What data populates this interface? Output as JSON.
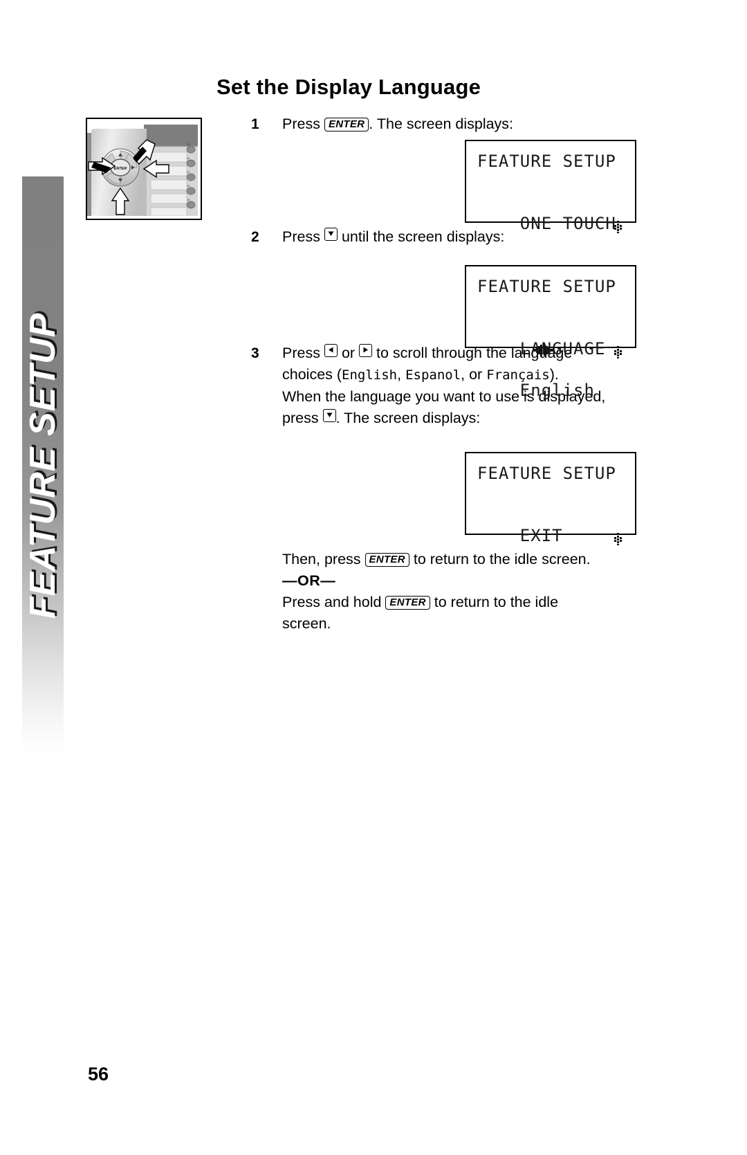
{
  "side_tab": {
    "label": "FEATURE SETUP"
  },
  "page": {
    "title": "Set the Display Language",
    "number": "56"
  },
  "figure": {
    "name": "phone-navigation-keypad-illustration",
    "enter_key_label": "ENTER",
    "speed_dial_labels": [
      "10",
      "11",
      "12",
      "13",
      "14"
    ]
  },
  "steps": [
    {
      "num": "1",
      "text_before": "Press",
      "key": "ENTER",
      "text_after": ". The screen displays:"
    },
    {
      "num": "2",
      "text_before": "Press",
      "key_icon": "down-arrow",
      "text_after": "until the screen displays:"
    },
    {
      "num": "3",
      "line1_a": "Press",
      "key_icon_left": "left-arrow",
      "line1_b": "or",
      "key_icon_right": "right-arrow",
      "line1_c": "to scroll through the language",
      "line2_a": "choices (",
      "lang1": "English",
      "line2_b": ", ",
      "lang2": "Espanol",
      "line2_c": ", or ",
      "lang3": "Français",
      "line2_d": ").",
      "line3": "When the language you want to use is displayed,",
      "line4_a": "press",
      "key_icon_down": "down-arrow",
      "line4_b": ". The screen displays:"
    }
  ],
  "lcd_screens": [
    {
      "id": "lcd-screen-1",
      "line1": "FEATURE SETUP",
      "line2": "",
      "line3": "ONE TOUCH",
      "scroll_indicator": true,
      "has_arrows": false
    },
    {
      "id": "lcd-screen-2",
      "line1": "FEATURE SETUP",
      "line2_arrows": "◀▶",
      "line2": "English",
      "line3": "LANGUAGE",
      "scroll_indicator": true,
      "has_arrows": true
    },
    {
      "id": "lcd-screen-3",
      "line1": "FEATURE SETUP",
      "line2": "",
      "line3": "EXIT",
      "scroll_indicator": true,
      "has_arrows": false
    }
  ],
  "closing": {
    "line1_a": "Then, press",
    "key1": "ENTER",
    "line1_b": "to return to the idle screen.",
    "or_label": "—OR—",
    "line2_a": "Press and hold",
    "key2": "ENTER",
    "line2_b": "to return to the idle",
    "line3": "screen."
  },
  "colors": {
    "tab_gray": "#808080",
    "text": "#000000",
    "lcd_text": "#1a1a1a"
  }
}
